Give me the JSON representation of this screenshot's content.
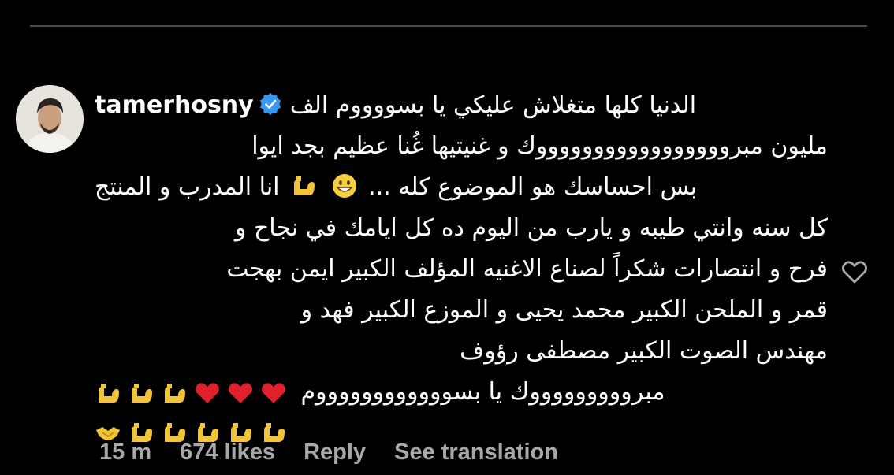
{
  "comment": {
    "username": "tamerhosny",
    "verified": true,
    "lines": [
      "الدنيا كلها متغلاش عليكي يا بسووووم الف",
      "مليون مبروووووووووووووووووك و غنيتيها غُنا عظيم بجد ايوا",
      "بس احساسك هو الموضوع كله ...",
      "انا المدرب و المنتج",
      "كل سنه وانتي طيبه و يارب من اليوم ده كل ايامك في نجاح و",
      "فرح و انتصارات شكراً لصناع الاغنيه المؤلف الكبير ايمن بهجت",
      "قمر و الملحن الكبير محمد يحيى و الموزع الكبير فهد و",
      "مهندس الصوت الكبير مصطفى رؤوف",
      "مبروووووووووك يا بسووووووووووووم"
    ],
    "emoji_names": [
      "flexed-biceps",
      "red-heart",
      "grinning-face",
      "handshake"
    ]
  },
  "meta": {
    "time": "15 m",
    "likes": "674 likes",
    "reply": "Reply",
    "see_translation": "See translation"
  },
  "colors": {
    "background": "#000000",
    "text": "#ffffff",
    "meta_text": "#a8a8a8",
    "verified": "#3897f0",
    "divider": "#4a4a4a"
  }
}
